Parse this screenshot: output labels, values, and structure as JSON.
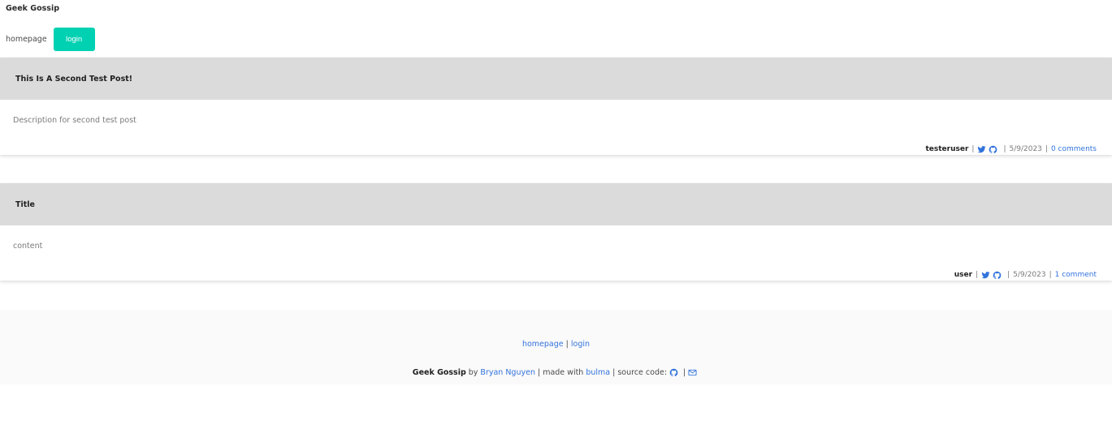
{
  "site": {
    "title": "Geek Gossip"
  },
  "nav": {
    "homepage_label": "homepage",
    "login_label": "login"
  },
  "colors": {
    "primary": "#00d1b2",
    "link": "#3273dc",
    "card_header": "#dbdbdb",
    "footer_bg": "#fafafa"
  },
  "posts": [
    {
      "title": "This Is A Second Test Post!",
      "description": "Description for second test post",
      "author": "testeruser",
      "date": "5/9/2023",
      "comments_label": "0 comments",
      "icons": [
        "twitter-icon",
        "github-icon"
      ]
    },
    {
      "title": "Title",
      "description": "content",
      "author": "user",
      "date": "5/9/2023",
      "comments_label": "1 comment",
      "icons": [
        "twitter-icon",
        "github-icon"
      ]
    }
  ],
  "footer": {
    "link_homepage": "homepage",
    "link_separator": "|",
    "link_login": "login",
    "brand": "Geek Gossip",
    "by_text": "by",
    "author_name": "Bryan Nguyen",
    "made_with_text": "| made with",
    "framework": "bulma",
    "source_code_text": "| source code:",
    "icon_separator": "|",
    "icons": [
      "github-icon",
      "email-icon"
    ]
  }
}
